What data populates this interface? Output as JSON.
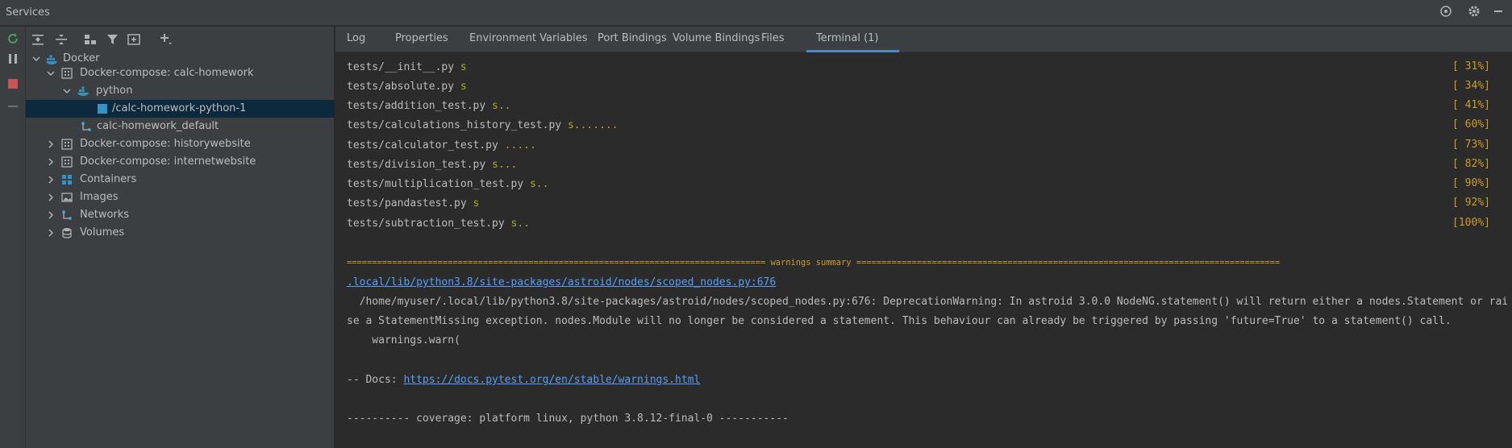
{
  "window": {
    "title": "Services"
  },
  "tree": {
    "items": [
      {
        "label": "Docker"
      },
      {
        "label": "Docker-compose: calc-homework"
      },
      {
        "label": "python"
      },
      {
        "label": "/calc-homework-python-1"
      },
      {
        "label": "calc-homework_default"
      },
      {
        "label": "Docker-compose: historywebsite"
      },
      {
        "label": "Docker-compose: internetwebsite"
      },
      {
        "label": "Containers"
      },
      {
        "label": "Images"
      },
      {
        "label": "Networks"
      },
      {
        "label": "Volumes"
      }
    ]
  },
  "tabs": [
    {
      "label": "Log"
    },
    {
      "label": "Properties"
    },
    {
      "label": "Environment Variables"
    },
    {
      "label": "Port Bindings"
    },
    {
      "label": "Volume Bindings"
    },
    {
      "label": "Files"
    },
    {
      "label": "Terminal (1)"
    }
  ],
  "terminal": {
    "tests": [
      {
        "file": "tests/__init__.py",
        "marks": "s",
        "pct": "[ 31%]"
      },
      {
        "file": "tests/absolute.py",
        "marks": "s",
        "pct": "[ 34%]"
      },
      {
        "file": "tests/addition_test.py",
        "marks": "s..",
        "pct": "[ 41%]"
      },
      {
        "file": "tests/calculations_history_test.py",
        "marks": "s.......",
        "pct": "[ 60%]"
      },
      {
        "file": "tests/calculator_test.py",
        "marks": ".....",
        "pct": "[ 73%]"
      },
      {
        "file": "tests/division_test.py",
        "marks": "s...",
        "pct": "[ 82%]"
      },
      {
        "file": "tests/multiplication_test.py",
        "marks": "s..",
        "pct": "[ 90%]"
      },
      {
        "file": "tests/pandastest.py",
        "marks": "s",
        "pct": "[ 92%]"
      },
      {
        "file": "tests/subtraction_test.py",
        "marks": "s..",
        "pct": "[100%]"
      }
    ],
    "warnings_header": "=================================================================================== warnings summary ====================================================================================",
    "warning_path": ".local/lib/python3.8/site-packages/astroid/nodes/scoped_nodes.py:676",
    "warning_line1": "  /home/myuser/.local/lib/python3.8/site-packages/astroid/nodes/scoped_nodes.py:676: DeprecationWarning: In astroid 3.0.0 NodeNG.statement() will return either a nodes.Statement or rai",
    "warning_line2": "se a StatementMissing exception. nodes.Module will no longer be considered a statement. This behaviour can already be triggered by passing 'future=True' to a statement() call.",
    "warning_line3": "    warnings.warn(",
    "docs_prefix": "-- Docs: ",
    "docs_url": "https://docs.pytest.org/en/stable/warnings.html",
    "coverage_line": "---------- coverage: platform linux, python 3.8.12-final-0 -----------"
  }
}
